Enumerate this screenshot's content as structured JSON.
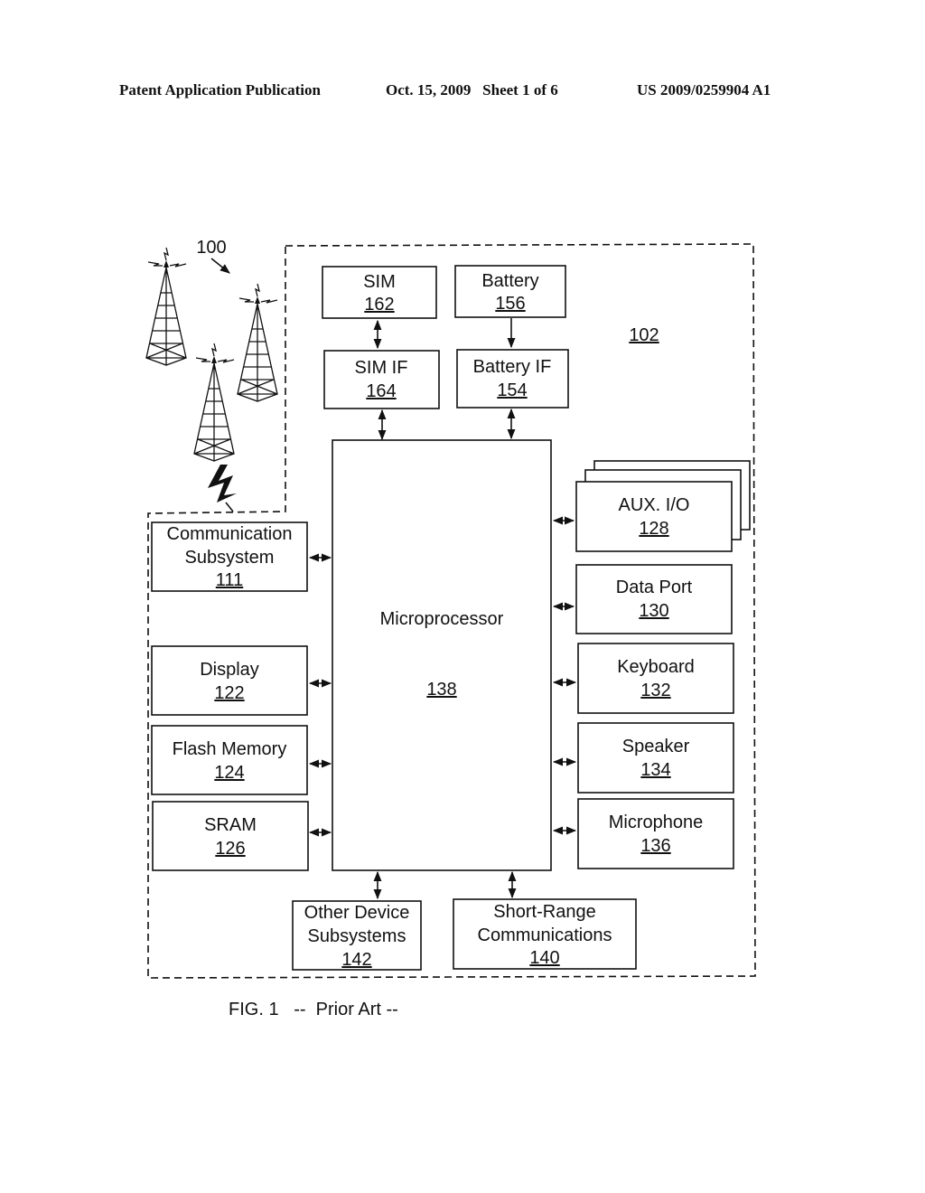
{
  "header": {
    "left": "Patent Application Publication",
    "middle": "Oct. 15, 2009   Sheet 1 of 6",
    "right": "US 2009/0259904 A1"
  },
  "figure": {
    "network_label": "100",
    "device_label": "102",
    "caption": "FIG. 1   --  Prior Art --",
    "blocks": {
      "sim": {
        "name": "SIM",
        "ref": "162"
      },
      "battery": {
        "name": "Battery",
        "ref": "156"
      },
      "sim_if": {
        "name": "SIM IF",
        "ref": "164"
      },
      "battery_if": {
        "name": "Battery IF",
        "ref": "154"
      },
      "microprocessor": {
        "name": "Microprocessor",
        "ref": "138"
      },
      "comm": {
        "name1": "Communication",
        "name2": "Subsystem",
        "ref": "111"
      },
      "display": {
        "name": "Display",
        "ref": "122"
      },
      "flash": {
        "name": "Flash Memory",
        "ref": "124"
      },
      "sram": {
        "name": "SRAM",
        "ref": "126"
      },
      "aux": {
        "name": "AUX. I/O",
        "ref": "128"
      },
      "dataport": {
        "name": "Data Port",
        "ref": "130"
      },
      "keyboard": {
        "name": "Keyboard",
        "ref": "132"
      },
      "speaker": {
        "name": "Speaker",
        "ref": "134"
      },
      "microphone": {
        "name": "Microphone",
        "ref": "136"
      },
      "other": {
        "name1": "Other Device",
        "name2": "Subsystems",
        "ref": "142"
      },
      "shortrange": {
        "name1": "Short-Range",
        "name2": "Communications",
        "ref": "140"
      }
    }
  }
}
